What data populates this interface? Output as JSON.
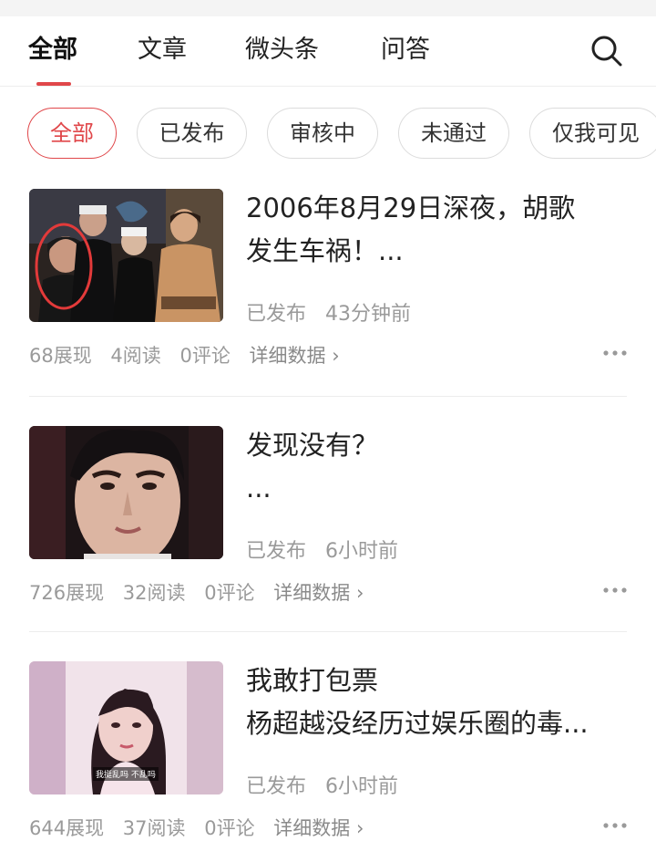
{
  "tabs": [
    {
      "label": "全部"
    },
    {
      "label": "文章"
    },
    {
      "label": "微头条"
    },
    {
      "label": "问答"
    }
  ],
  "search_icon": "search-icon",
  "filters": [
    {
      "label": "全部"
    },
    {
      "label": "已发布"
    },
    {
      "label": "审核中"
    },
    {
      "label": "未通过"
    },
    {
      "label": "仅我可见"
    }
  ],
  "accent_color": "#e0474a",
  "posts": [
    {
      "title_line1": "2006年8月29日深夜，胡歌",
      "title_line2": "发生车祸！...",
      "status": "已发布",
      "time": "43分钟前",
      "impressions": "68展现",
      "reads": "4阅读",
      "comments": "0评论",
      "details": "详细数据 ›"
    },
    {
      "title_line1": "发现没有？",
      "title_line2": "...",
      "status": "已发布",
      "time": "6小时前",
      "impressions": "726展现",
      "reads": "32阅读",
      "comments": "0评论",
      "details": "详细数据 ›"
    },
    {
      "title_line1": "我敢打包票",
      "title_line2": "杨超越没经历过娱乐圈的毒...",
      "status": "已发布",
      "time": "6小时前",
      "impressions": "644展现",
      "reads": "37阅读",
      "comments": "0评论",
      "details": "详细数据 ›",
      "thumb_caption": "我挺乱吗 不乱吗"
    }
  ]
}
